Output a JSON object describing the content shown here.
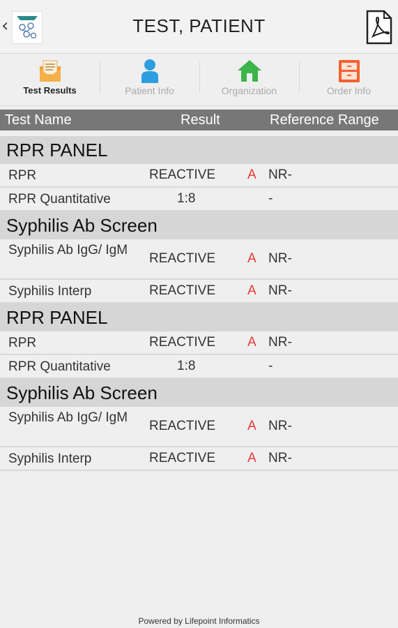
{
  "header": {
    "back_glyph": "‹",
    "title": "TEST, PATIENT",
    "pdf_icon": "pdf-icon"
  },
  "tabs": [
    {
      "label": "Test Results",
      "icon": "test-results-icon",
      "active": true
    },
    {
      "label": "Patient Info",
      "icon": "person-icon",
      "active": false
    },
    {
      "label": "Organization",
      "icon": "home-icon",
      "active": false
    },
    {
      "label": "Order Info",
      "icon": "cabinet-icon",
      "active": false
    }
  ],
  "table": {
    "headers": {
      "name": "Test Name",
      "result": "Result",
      "range": "Reference Range"
    },
    "groups": [
      {
        "title": "RPR PANEL",
        "rows": [
          {
            "name": "RPR",
            "result": "REACTIVE",
            "flag": "A",
            "range": "NR-"
          },
          {
            "name": "RPR Quantitative",
            "result": "1:8",
            "flag": "",
            "range": "-"
          }
        ]
      },
      {
        "title": "Syphilis Ab Screen",
        "rows": [
          {
            "name": "Syphilis Ab IgG/ IgM",
            "result": "REACTIVE",
            "flag": "A",
            "range": "NR-"
          },
          {
            "name": "Syphilis Interp",
            "result": "REACTIVE",
            "flag": "A",
            "range": "NR-"
          }
        ]
      },
      {
        "title": "RPR PANEL",
        "rows": [
          {
            "name": "RPR",
            "result": "REACTIVE",
            "flag": "A",
            "range": "NR-"
          },
          {
            "name": "RPR Quantitative",
            "result": "1:8",
            "flag": "",
            "range": "-"
          }
        ]
      },
      {
        "title": "Syphilis Ab Screen",
        "rows": [
          {
            "name": "Syphilis Ab IgG/ IgM",
            "result": "REACTIVE",
            "flag": "A",
            "range": "NR-"
          },
          {
            "name": "Syphilis Interp",
            "result": "REACTIVE",
            "flag": "A",
            "range": "NR-"
          }
        ]
      }
    ]
  },
  "footer": {
    "text": "Powered by Lifepoint Informatics"
  },
  "colors": {
    "flag": "#e53935",
    "header_bg": "#777777",
    "section_bg": "#d6d6d6"
  }
}
